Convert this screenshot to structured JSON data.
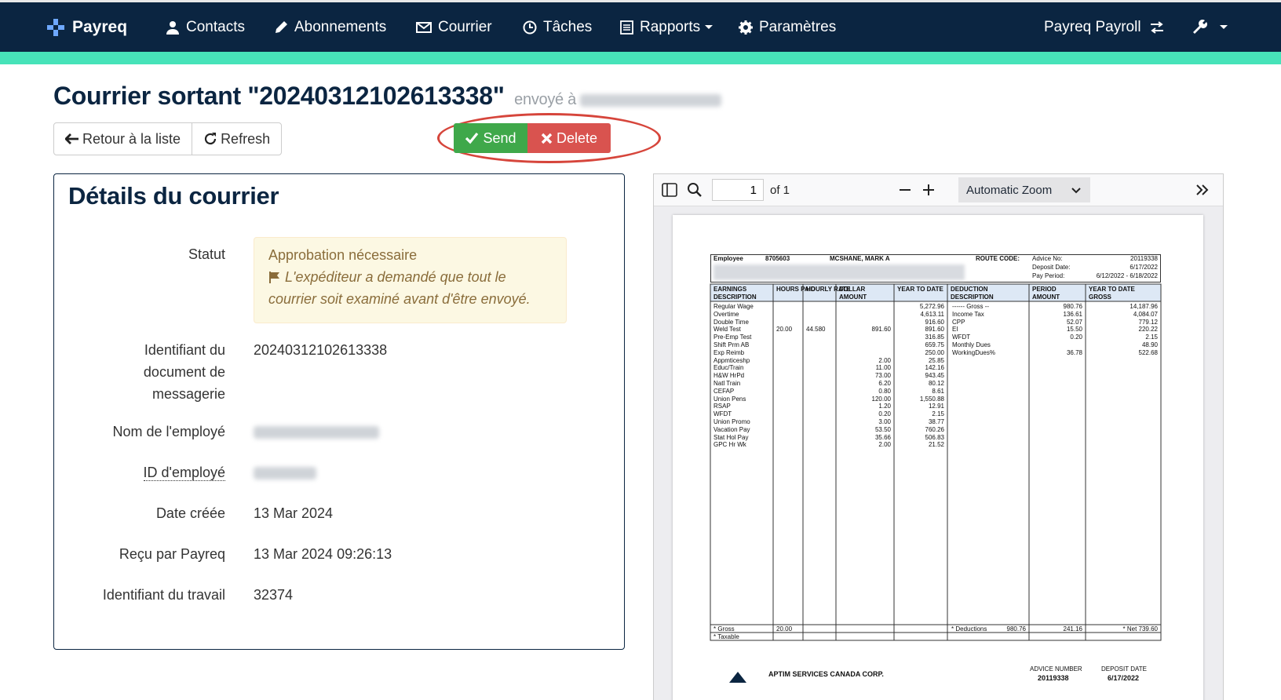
{
  "nav": {
    "brand": "Payreq",
    "items": [
      {
        "label": "Contacts",
        "icon": "user-icon"
      },
      {
        "label": "Abonnements",
        "icon": "pencil-icon"
      },
      {
        "label": "Courrier",
        "icon": "envelope-icon"
      },
      {
        "label": "Tâches",
        "icon": "clock-icon"
      },
      {
        "label": "Rapports",
        "icon": "report-icon"
      },
      {
        "label": "Paramètres",
        "icon": "gear-icon"
      }
    ],
    "account": "Payreq Payroll"
  },
  "page": {
    "title": "Courrier sortant \"20240312102613338\"",
    "subtitle": "envoyé à"
  },
  "actions": {
    "back": "Retour à la liste",
    "refresh": "Refresh",
    "send": "Send",
    "delete": "Delete"
  },
  "details": {
    "heading": "Détails du courrier",
    "status_label": "Statut",
    "status_value": "Approbation nécessaire",
    "status_note": "L'expéditeur a demandé que tout le courrier soit examiné avant d'être envoyé.",
    "doc_id_label": "Identifiant du document de messagerie",
    "doc_id_value": "20240312102613338",
    "employee_name_label": "Nom de l'employé",
    "employee_id_label": "ID d'employé",
    "created_label": "Date créée",
    "created_value": "13 Mar 2024",
    "received_label": "Reçu par Payreq",
    "received_value": "13 Mar 2024 09:26:13",
    "job_id_label": "Identifiant du travail",
    "job_id_value": "32374"
  },
  "viewer": {
    "page_number": "1",
    "page_count": "of 1",
    "zoom": "Automatic Zoom"
  },
  "slip": {
    "employee_label": "Employee",
    "employee_no": "8705603",
    "employee_name": "MCSHANE, MARK A",
    "route_code": "ROUTE CODE:",
    "advice_no_label": "Advice No:",
    "advice_no": "20119338",
    "deposit_date_label": "Deposit Date:",
    "deposit_date": "6/17/2022",
    "pay_period_label": "Pay Period:",
    "pay_period": "6/12/2022 - 6/18/2022",
    "headers": [
      "EARNINGS DESCRIPTION",
      "HOURS PAID",
      "HOURLY RATE",
      "DOLLAR AMOUNT",
      "YEAR TO DATE",
      "DEDUCTION DESCRIPTION",
      "PERIOD AMOUNT",
      "YEAR TO DATE GROSS"
    ],
    "earnings": [
      [
        "Regular Wage",
        "",
        "",
        "",
        "5,272.96"
      ],
      [
        "Overtime",
        "",
        "",
        "",
        "4,613.11"
      ],
      [
        "Double Time",
        "",
        "",
        "",
        "916.60"
      ],
      [
        "Weld Test",
        "20.00",
        "44.580",
        "891.60",
        "891.60"
      ],
      [
        "Pre-Emp Test",
        "",
        "",
        "",
        "316.85"
      ],
      [
        "Shift Prm AB",
        "",
        "",
        "",
        "659.75"
      ],
      [
        "Exp Reimb",
        "",
        "",
        "",
        "250.00"
      ],
      [
        "Appmticeshp",
        "",
        "",
        "2.00",
        "25.85"
      ],
      [
        "Educ/Train",
        "",
        "",
        "11.00",
        "142.16"
      ],
      [
        "H&W HrPd",
        "",
        "",
        "73.00",
        "943.45"
      ],
      [
        "Natl Train",
        "",
        "",
        "6.20",
        "80.12"
      ],
      [
        "CEFAP",
        "",
        "",
        "0.80",
        "8.61"
      ],
      [
        "Union Pens",
        "",
        "",
        "120.00",
        "1,550.88"
      ],
      [
        "RSAP",
        "",
        "",
        "1.20",
        "12.91"
      ],
      [
        "WFDT",
        "",
        "",
        "0.20",
        "2.15"
      ],
      [
        "Union Promo",
        "",
        "",
        "3.00",
        "38.77"
      ],
      [
        "Vacation Pay",
        "",
        "",
        "53.50",
        "760.26"
      ],
      [
        "Stat Hol Pay",
        "",
        "",
        "35.66",
        "506.83"
      ],
      [
        "GPC Hr Wk",
        "",
        "",
        "2.00",
        "21.52"
      ]
    ],
    "deductions": [
      [
        "------ Gross --",
        "980.76",
        "14,187.96"
      ],
      [
        "Income Tax",
        "136.61",
        "4,084.07"
      ],
      [
        "CPP",
        "52.07",
        "779.12"
      ],
      [
        "EI",
        "15.50",
        "220.22"
      ],
      [
        "WFDT",
        "0.20",
        "2.15"
      ],
      [
        "Monthly Dues",
        "",
        "48.90"
      ],
      [
        "WorkingDues%",
        "36.78",
        "522.68"
      ]
    ],
    "gross_label": "* Gross",
    "gross_hours": "20.00",
    "gross_amount": "980.76",
    "taxable_label": "* Taxable",
    "deductions_label": "* Deductions",
    "deductions_amount": "241.16",
    "net_label": "* Net 739.60",
    "company": "APTIM SERVICES CANADA CORP.",
    "advice_number_label": "ADVICE NUMBER",
    "advice_number": "20119338",
    "deposit_label": "DEPOSIT DATE",
    "deposit_value": "6/17/2022"
  },
  "colors": {
    "nav": "#0b2541",
    "accent": "#47e3b9",
    "send": "#3fa84a",
    "delete": "#d9534f",
    "highlight": "#d6453b"
  }
}
